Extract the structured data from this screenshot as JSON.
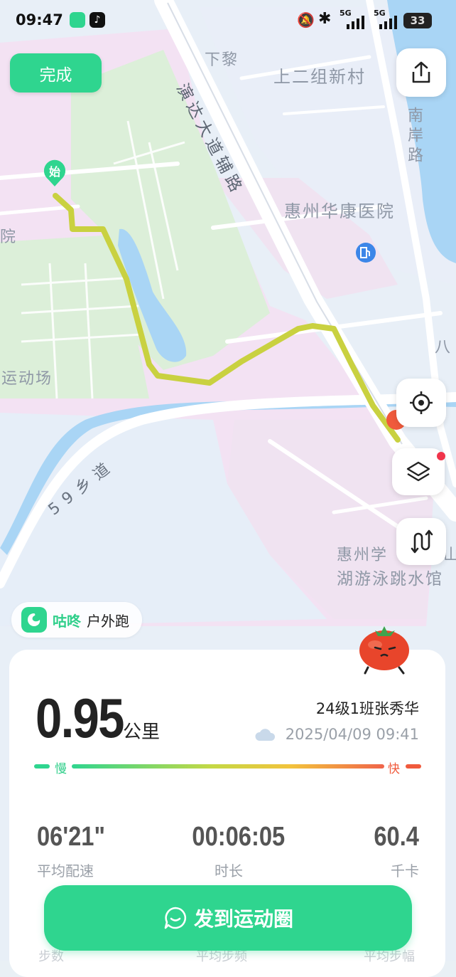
{
  "status_bar": {
    "time": "09:47",
    "battery": "33",
    "network": "5G"
  },
  "map": {
    "labels": {
      "xiali": "下黎",
      "shangerzu": "上二组新村",
      "yanda": "演达大道辅路",
      "nanan": "南岸路",
      "hospital": "惠州华康医院",
      "yuan": "院",
      "stadium": "运动场",
      "road59": "59乡道",
      "ba": "八",
      "school": "惠州学",
      "shan": "山",
      "swim": "湖游泳跳水馆"
    },
    "start_marker": "始",
    "colors": {
      "route": "#c9d140",
      "road": "#ffffff",
      "water": "#a9d5f5"
    }
  },
  "toolbar": {
    "done_label": "完成"
  },
  "brand": {
    "name": "咕咚",
    "mode": "户外跑"
  },
  "summary": {
    "distance": "0.95",
    "distance_unit": "公里",
    "user": "24级1班张秀华",
    "datetime": "2025/04/09 09:41",
    "pace_slow": "慢",
    "pace_fast": "快"
  },
  "stats": {
    "avg_pace": {
      "value": "06'21\"",
      "label": "平均配速"
    },
    "duration": {
      "value": "00:06:05",
      "label": "时长"
    },
    "calories": {
      "value": "60.4",
      "label": "千卡"
    }
  },
  "peek_labels": [
    "步数",
    "平均步频",
    "平均步幅"
  ],
  "share": {
    "label": "发到运动圈"
  }
}
